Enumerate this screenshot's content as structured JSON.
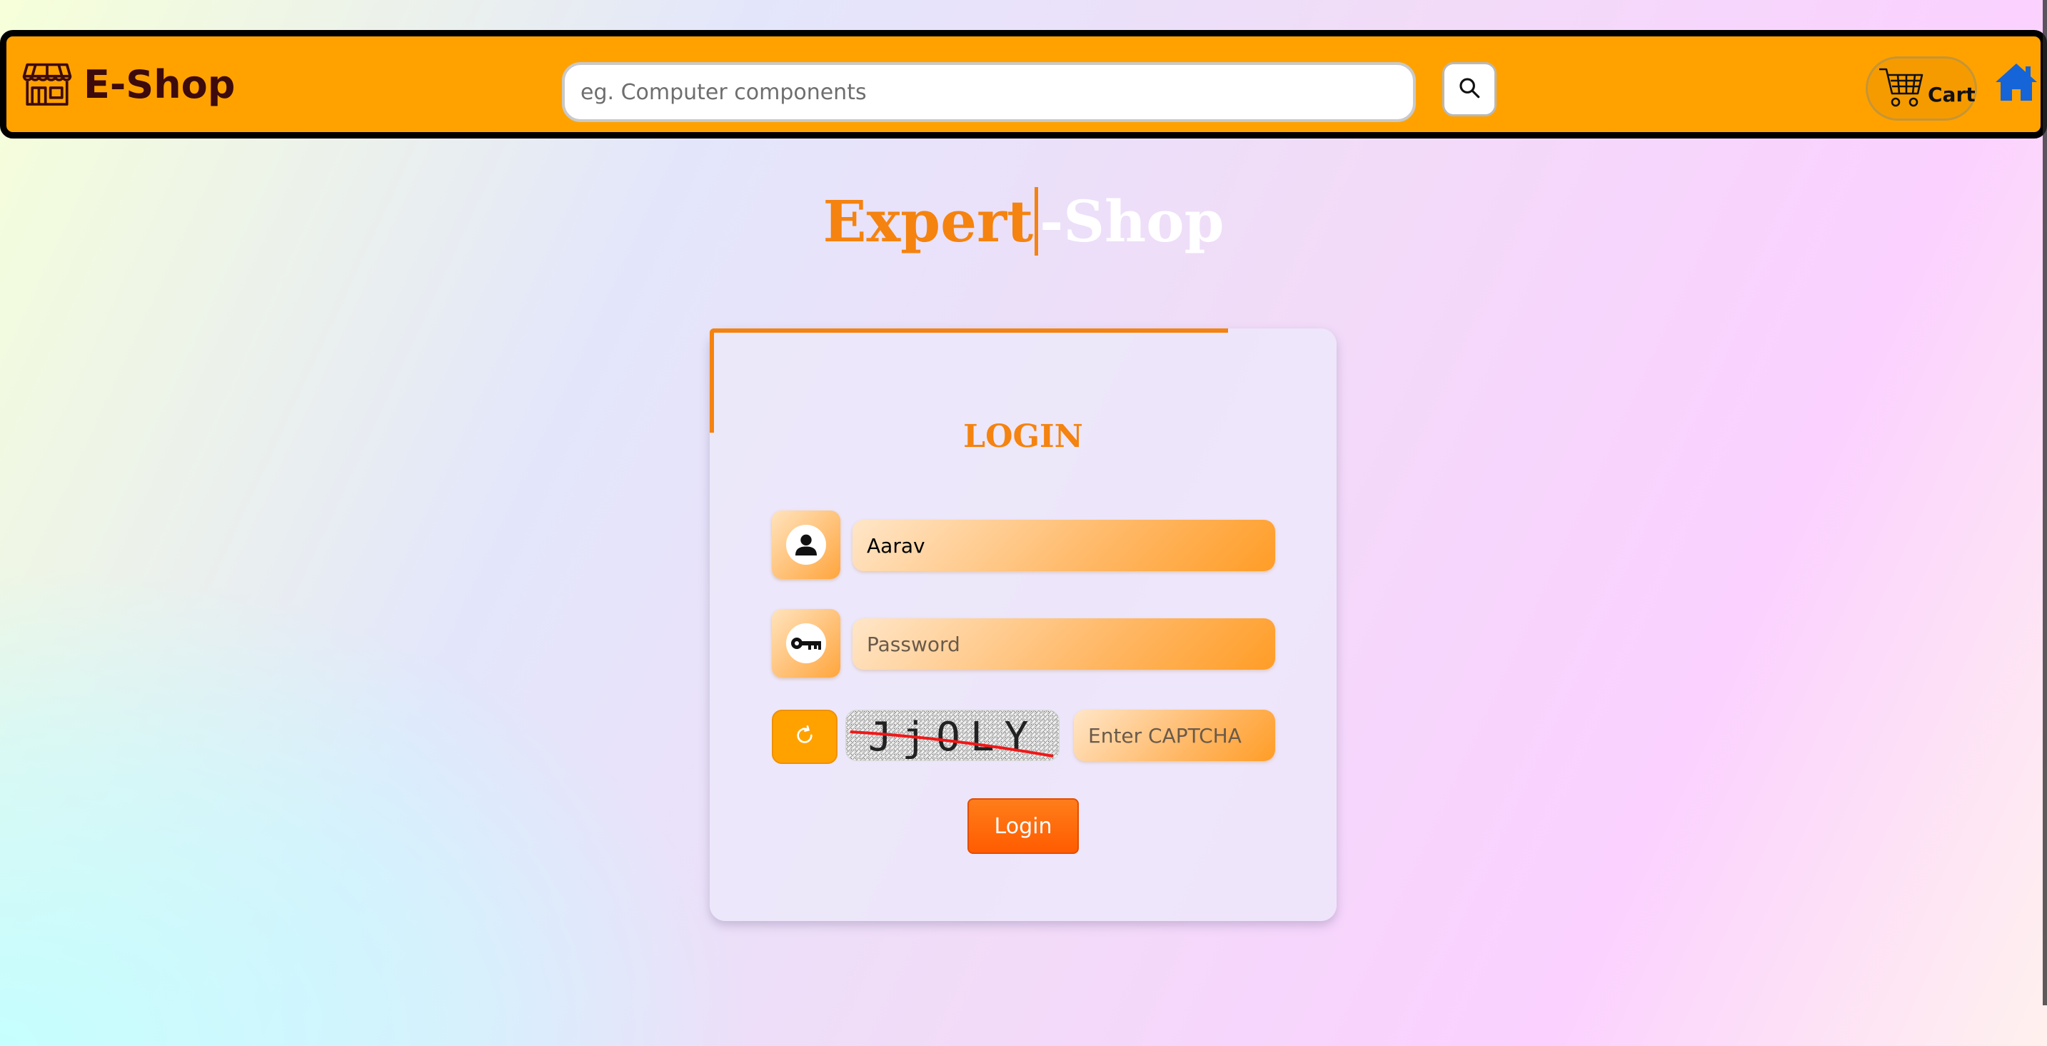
{
  "header": {
    "logo_text": "E-Shop",
    "search_placeholder": "eg. Computer components",
    "cart_label": "Cart"
  },
  "brand": {
    "left": "Expert",
    "right": "-Shop"
  },
  "login": {
    "title": "LOGIN",
    "username_value": "Aarav",
    "password_placeholder": "Password",
    "captcha_text": "JjOLY",
    "captcha_placeholder": "Enter CAPTCHA",
    "submit_label": "Login"
  },
  "colors": {
    "header_bg": "#ffa200",
    "accent": "#f5830f",
    "login_button": "#ff6200",
    "home_icon": "#1565d8"
  },
  "icons": [
    "shop-icon",
    "search-icon",
    "cart-icon",
    "home-icon",
    "user-icon",
    "key-icon",
    "refresh-icon"
  ]
}
